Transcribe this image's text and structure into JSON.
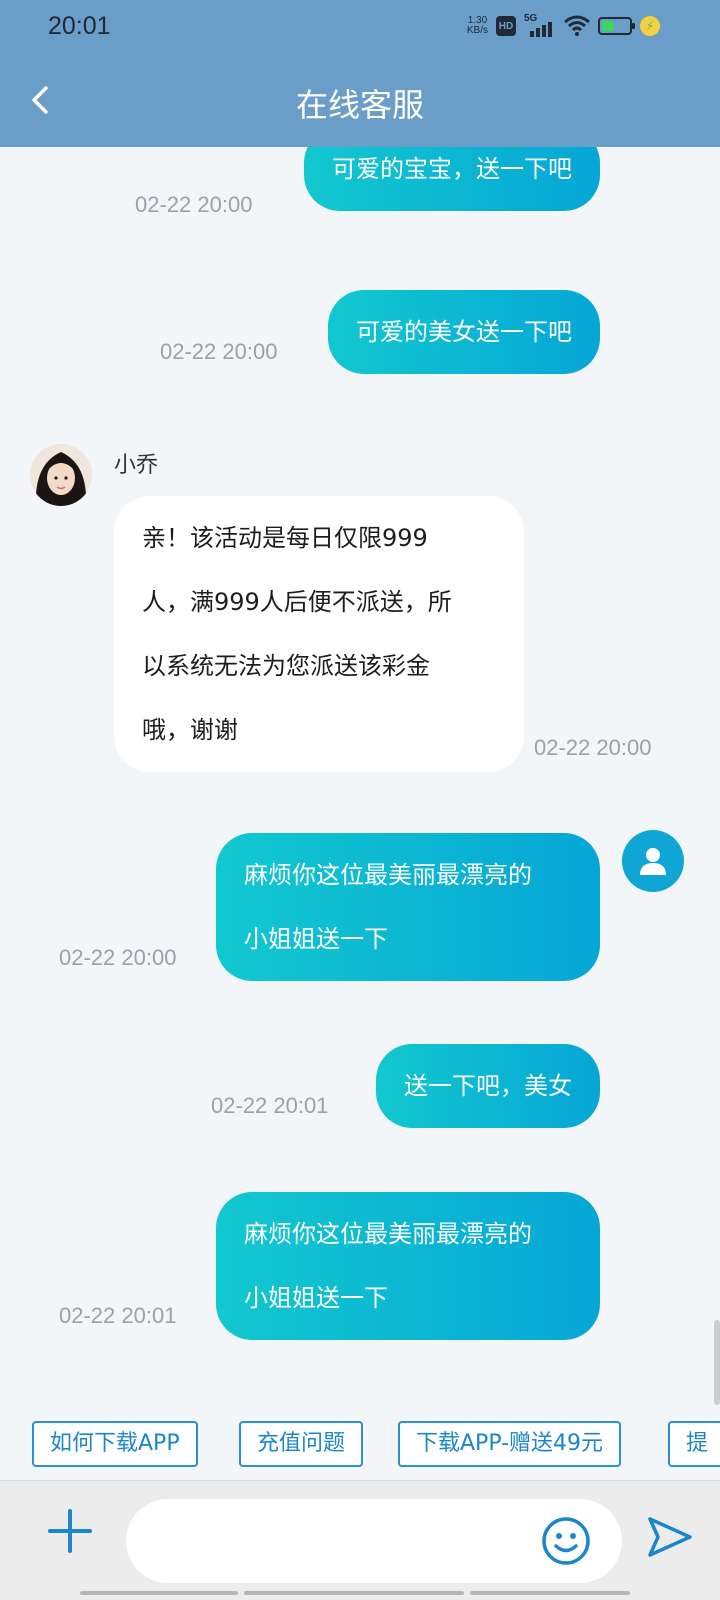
{
  "status": {
    "time": "20:01",
    "speed_value": "1.30",
    "speed_unit": "KB/s",
    "hd": "HD",
    "network": "5G",
    "battery_level": 0.45
  },
  "header": {
    "title": "在线客服",
    "back_icon": "chevron-left-icon"
  },
  "messages": [
    {
      "from": "user",
      "text": "可爱的宝宝，送一下吧",
      "time": "02-22 20:00"
    },
    {
      "from": "user",
      "text": "可爱的美女送一下吧",
      "time": "02-22 20:00"
    },
    {
      "from": "agent",
      "name": "小乔",
      "lines": [
        "亲！该活动是每日仅限999",
        "人，满999人后便不派送，所",
        "以系统无法为您派送该彩金",
        "哦，谢谢"
      ],
      "time": "02-22 20:00"
    },
    {
      "from": "user",
      "lines": [
        "麻烦你这位最美丽最漂亮的",
        "小姐姐送一下"
      ],
      "time": "02-22 20:00"
    },
    {
      "from": "user",
      "text": "送一下吧，美女",
      "time": "02-22 20:01"
    },
    {
      "from": "user",
      "lines": [
        "麻烦你这位最美丽最漂亮的",
        "小姐姐送一下"
      ],
      "time": "02-22 20:01"
    }
  ],
  "quick_replies": [
    "如何下载APP",
    "充值问题",
    "下载APP-赠送49元",
    "提"
  ],
  "input": {
    "placeholder": "",
    "plus_icon": "plus-icon",
    "emoji_icon": "smiley-icon",
    "send_icon": "send-icon"
  },
  "colors": {
    "header_bg": "#6a9dc8",
    "bubble_gradient_start": "#12c8cf",
    "bubble_gradient_end": "#06a6d6",
    "accent": "#1b86cc"
  }
}
